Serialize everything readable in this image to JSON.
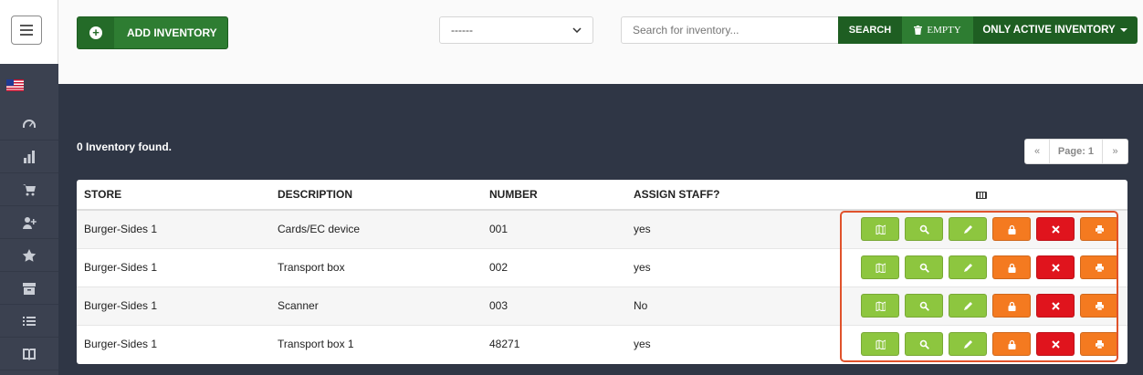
{
  "toolbar": {
    "add_label": "ADD INVENTORY",
    "store_select_value": "------",
    "search_placeholder": "Search for inventory...",
    "search_label": "SEARCH",
    "empty_label": "EMPTY",
    "active_label": "ONLY ACTIVE INVENTORY"
  },
  "sidebar": {
    "items": [
      "flag-us-icon",
      "dashboard-icon",
      "bar-chart-icon",
      "cart-icon",
      "add-user-icon",
      "star-icon",
      "archive-icon",
      "list-icon",
      "book-icon"
    ]
  },
  "main": {
    "count_text": "0 Inventory found.",
    "pager": {
      "prev": "«",
      "current": "Page: 1",
      "next": "»"
    }
  },
  "table": {
    "headers": [
      "STORE",
      "DESCRIPTION",
      "NUMBER",
      "ASSIGN STAFF?"
    ],
    "rows": [
      {
        "store": "Burger-Sides 1",
        "description": "Cards/EC device",
        "number": "001",
        "assign": "yes"
      },
      {
        "store": "Burger-Sides 1",
        "description": "Transport box",
        "number": "002",
        "assign": "yes"
      },
      {
        "store": "Burger-Sides 1",
        "description": "Scanner",
        "number": "003",
        "assign": "No"
      },
      {
        "store": "Burger-Sides 1",
        "description": "Transport box 1",
        "number": "48271",
        "assign": "yes"
      }
    ],
    "actions": [
      "map-icon",
      "search-icon",
      "pencil-icon",
      "lock-icon",
      "close-icon",
      "print-icon"
    ]
  },
  "colors": {
    "green": "#2e7d32",
    "dark_green": "#1e5e22",
    "light_green": "#8dc63f",
    "orange": "#f47a20",
    "red": "#e0141d"
  }
}
